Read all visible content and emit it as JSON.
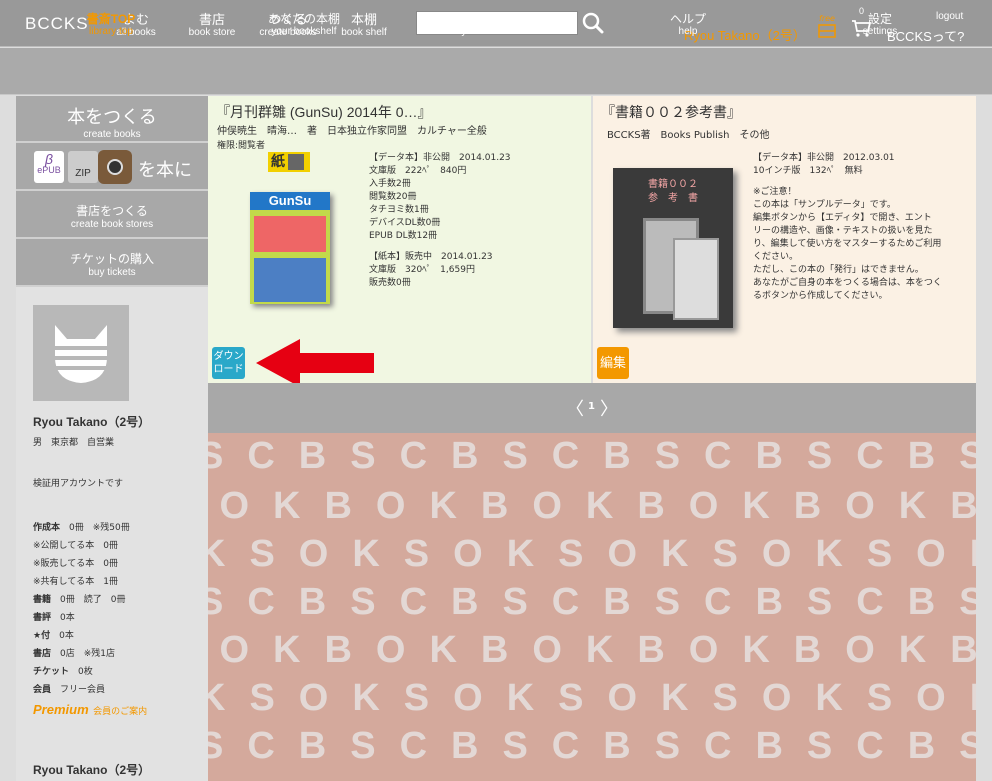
{
  "header": {
    "logo": "BCCKS",
    "nav": [
      {
        "ja": "よむ",
        "en": "all books"
      },
      {
        "ja": "書店",
        "en": "book store"
      },
      {
        "ja": "つくる",
        "en": "create books"
      },
      {
        "ja": "本棚",
        "en": "book shelf"
      }
    ],
    "search_value": "",
    "user": "Ryou Takano（2号）",
    "free": "free",
    "cart_count": "0",
    "logout": "logout",
    "about": "BCCKSって?"
  },
  "nav2": [
    {
      "ja": "書斎TOP",
      "en": "library top"
    },
    {
      "ja": "あなたの本棚",
      "en": "your bookshelf"
    },
    {
      "ja": "あなたの書店",
      "en": "your book store"
    },
    {
      "ja": "ヘルプ",
      "en": "help"
    },
    {
      "ja": "設定",
      "en": "settings"
    }
  ],
  "sidebar": {
    "create_ja": "本をつくる",
    "create_en": "create books",
    "formats": [
      "ePUB",
      "ZIP"
    ],
    "formats_text": "を本に",
    "store_ja": "書店をつくる",
    "store_en": "create book stores",
    "tickets_ja": "チケットの購入",
    "tickets_en": "buy tickets",
    "name": "Ryou Takano（2号）",
    "profile": "男　東京都　自営業",
    "bio": "検証用アカウントです",
    "stats": [
      {
        "k": "作成本",
        "v": "0冊　※残50冊"
      },
      {
        "k": "※公開してる本",
        "v": "0冊"
      },
      {
        "k": "※販売してる本",
        "v": "0冊"
      },
      {
        "k": "※共有してる本",
        "v": "1冊"
      },
      {
        "k": "書籍",
        "v": "0冊　読了　0冊"
      },
      {
        "k": "書評",
        "v": "0本"
      },
      {
        "k": "★付",
        "v": "0本"
      },
      {
        "k": "書店",
        "v": "0店　※残1店"
      },
      {
        "k": "チケット",
        "v": "0枚"
      },
      {
        "k": "会員",
        "v": "フリー会員"
      }
    ],
    "premium": "Premium",
    "premium_text": "会員のご案内",
    "name2": "Ryou Takano（2号）"
  },
  "book1": {
    "title": "『月刊群雛 (GunSu) 2014年 0…』",
    "authors": "仲俣暁生　晴海…　著　日本独立作家同盟　カルチャー全般",
    "perm": "権限:閲覧者",
    "type_label": "紙",
    "cover_text": "GunSu",
    "info": [
      "【データ本】非公開　2014.01.23",
      "文庫版　222ﾍﾟ　840円",
      "入手数2冊",
      "閲覧数20冊",
      "タチヨミ数1冊",
      "デバイスDL数0冊",
      "EPUB DL数12冊",
      "",
      "【紙本】販売中　2014.01.23",
      "文庫版　320ﾍﾟ　1,659円",
      "販売数0冊"
    ],
    "download": "ダウンロード"
  },
  "book2": {
    "title": "『書籍００２参考書』",
    "authors": "BCCKS著　Books Publish　その他",
    "cover_text": "書籍００２\n参　考　書",
    "info": [
      "【データ本】非公開　2012.03.01",
      "10インチ版　132ﾍﾟ　無料",
      "",
      "※ご注意！",
      "この本は「サンプルデータ」です。",
      "編集ボタンから【エディタ】で開き、エント",
      "リーの構造や、画像・テキストの扱いを見た",
      "り、編集して使い方をマスターするためご利用",
      "ください。",
      "ただし、この本の「発行」はできません。",
      "あなたがご自身の本をつくる場合は、本をつく",
      "るボタンから作成してください。"
    ],
    "edit": "編集"
  },
  "pager": {
    "page": "1",
    "prev": "〈",
    "next": "〉"
  },
  "pattern_rows": [
    "SCBSCBSCBSCBSCBSCB",
    "BOKBOKBOKBOKBOKBOK",
    "KSOKSOKSOKSOKSOKSO",
    "SCBSCBSCBSCBSCBSCB",
    "BOKBOKBOKBOKBOKBOK",
    "KSOKSOKSOKSOKSOKSO",
    "SCBSCBSCBSCBSCBSCB"
  ],
  "colors": {
    "accent": "#f39800",
    "topbar": "#999999",
    "download": "#2aa8c9",
    "arrow": "#e60012"
  }
}
